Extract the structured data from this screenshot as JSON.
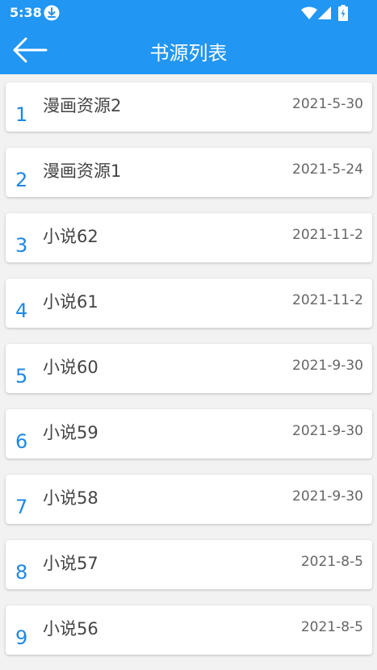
{
  "status_bar": {
    "time": "5:38",
    "icons": [
      "download-icon",
      "wifi-icon",
      "signal-icon",
      "battery-icon"
    ]
  },
  "app_bar": {
    "title": "书源列表",
    "back_icon": "arrow-left-icon"
  },
  "colors": {
    "primary": "#2196f3",
    "index_text": "#1e88e5",
    "name_text": "#444444",
    "date_text": "#666666",
    "background": "#f2f2f2"
  },
  "sources": [
    {
      "index": "1",
      "name": "漫画资源2",
      "date": "2021-5-30"
    },
    {
      "index": "2",
      "name": "漫画资源1",
      "date": "2021-5-24"
    },
    {
      "index": "3",
      "name": "小说62",
      "date": "2021-11-2"
    },
    {
      "index": "4",
      "name": "小说61",
      "date": "2021-11-2"
    },
    {
      "index": "5",
      "name": "小说60",
      "date": "2021-9-30"
    },
    {
      "index": "6",
      "name": "小说59",
      "date": "2021-9-30"
    },
    {
      "index": "7",
      "name": "小说58",
      "date": "2021-9-30"
    },
    {
      "index": "8",
      "name": "小说57",
      "date": "2021-8-5"
    },
    {
      "index": "9",
      "name": "小说56",
      "date": "2021-8-5"
    }
  ]
}
